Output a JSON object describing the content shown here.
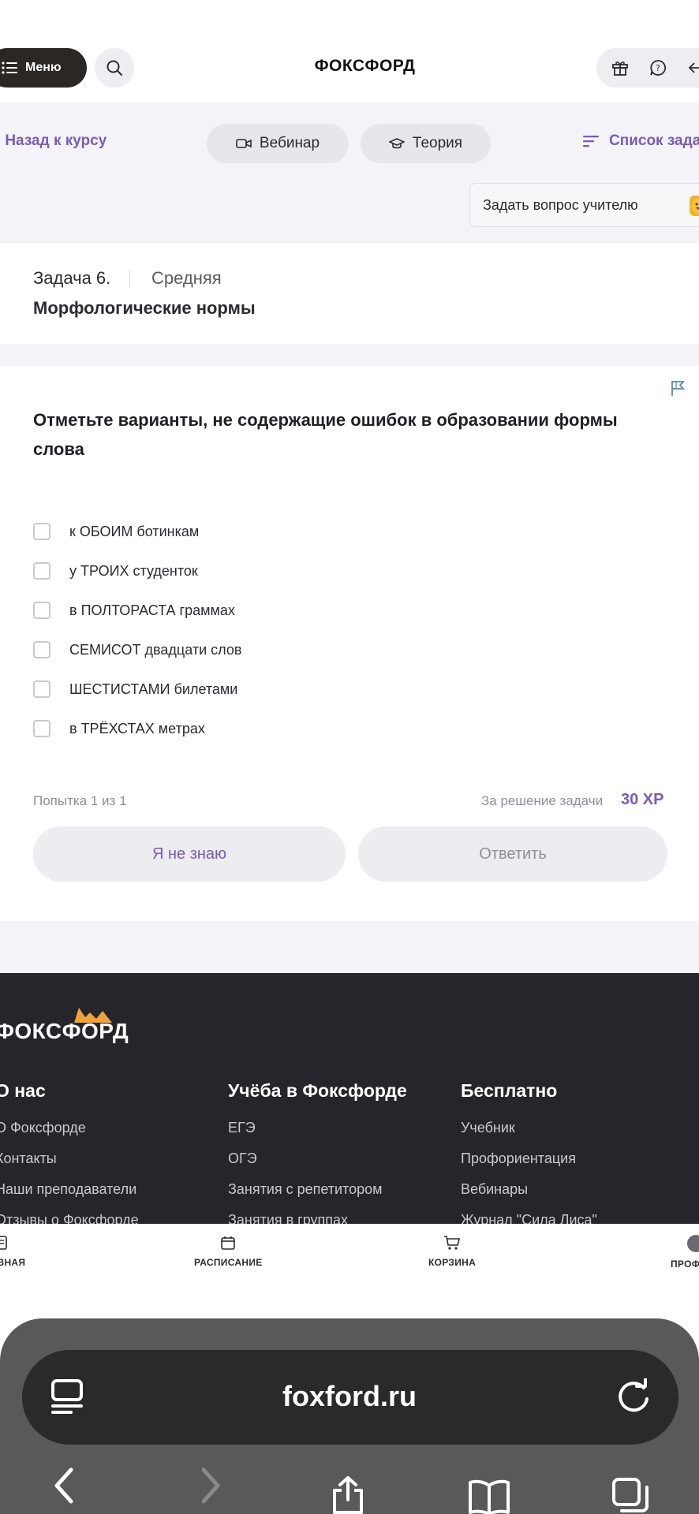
{
  "header": {
    "menu_label": "Меню",
    "logo": "ФОКСФОРД",
    "icons": [
      "menu-icon",
      "search-icon",
      "gift-icon",
      "help-icon",
      "exit-icon"
    ]
  },
  "subnav": {
    "back_label": "Назад к курсу",
    "webinar_label": "Вебинар",
    "theory_label": "Теория",
    "tasks_list_label": "Список задач",
    "ask_teacher_label": "Задать вопрос учителю"
  },
  "task": {
    "number": "Задача 6.",
    "level": "Средняя",
    "title": "Морфологические нормы"
  },
  "question": {
    "text": "Отметьте варианты, не содержащие ошибок в образовании формы слова",
    "options": [
      "к ОБОИМ ботинкам",
      "у ТРОИХ студенток",
      "в ПОЛТОРАСТА граммах",
      "СЕМИСОТ двадцати слов",
      "ШЕСТИСТАМИ билетами",
      "в ТРЁХСТАХ метрах"
    ],
    "attempt": "Попытка 1 из 1",
    "reward_label": "За решение задачи",
    "reward_xp": "30 XP",
    "dont_know_label": "Я не знаю",
    "answer_label": "Ответить"
  },
  "footer": {
    "logo": "ФОКСФОРД",
    "columns": [
      {
        "title": "О нас",
        "items": [
          "О Фоксфорде",
          "Контакты",
          "Наши преподаватели",
          "Отзывы о Фоксфорде"
        ]
      },
      {
        "title": "Учёба в Фоксфорде",
        "items": [
          "ЕГЭ",
          "ОГЭ",
          "Занятия с репетитором",
          "Занятия в группах"
        ]
      },
      {
        "title": "Бесплатно",
        "items": [
          "Учебник",
          "Профориентация",
          "Вебинары",
          "Журнал \"Сила Лиса\""
        ]
      }
    ]
  },
  "tabbar": {
    "items": [
      "ГЛАВНАЯ",
      "РАСПИСАНИЕ",
      "КОРЗИНА",
      "ПРОФИЛЬ"
    ]
  },
  "browser": {
    "url": "foxford.ru"
  },
  "colors": {
    "accent": "#7a5bb8",
    "dark": "#25252b",
    "page_bg": "#f4f4f8"
  }
}
